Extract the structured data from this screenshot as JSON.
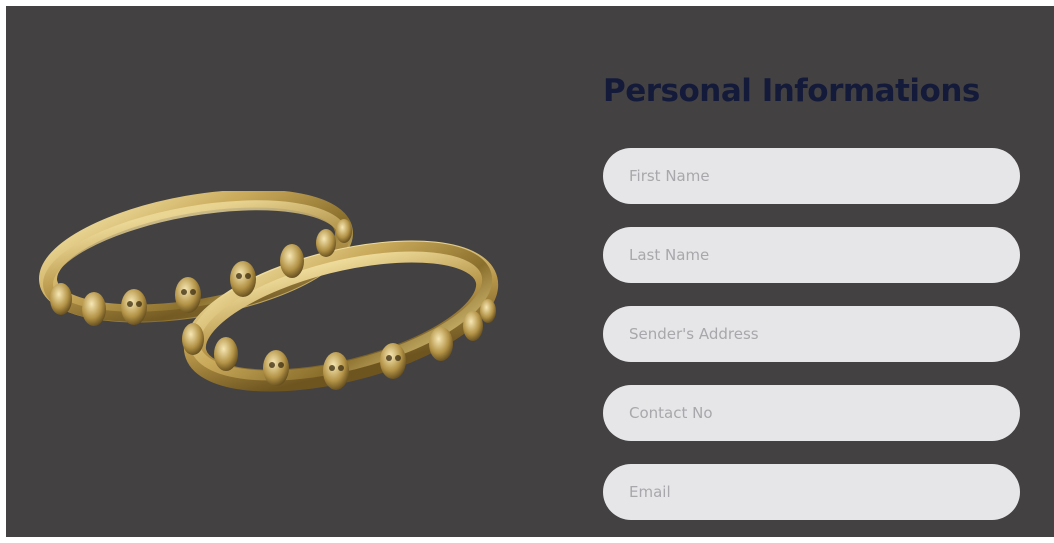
{
  "form": {
    "title": "Personal Informations",
    "fields": [
      {
        "name": "first-name",
        "placeholder": "First Name",
        "value": ""
      },
      {
        "name": "last-name",
        "placeholder": "Last Name",
        "value": ""
      },
      {
        "name": "sender-address",
        "placeholder": "Sender's Address",
        "value": ""
      },
      {
        "name": "contact-no",
        "placeholder": "Contact No",
        "value": ""
      },
      {
        "name": "email",
        "placeholder": "Email",
        "value": ""
      }
    ]
  },
  "colors": {
    "background": "#434142",
    "title": "#141a3a",
    "field_bg": "#e6e5e7",
    "placeholder": "#a8a8ac",
    "gold": "#c9a95a"
  },
  "image": {
    "name": "skull-rings-image"
  }
}
